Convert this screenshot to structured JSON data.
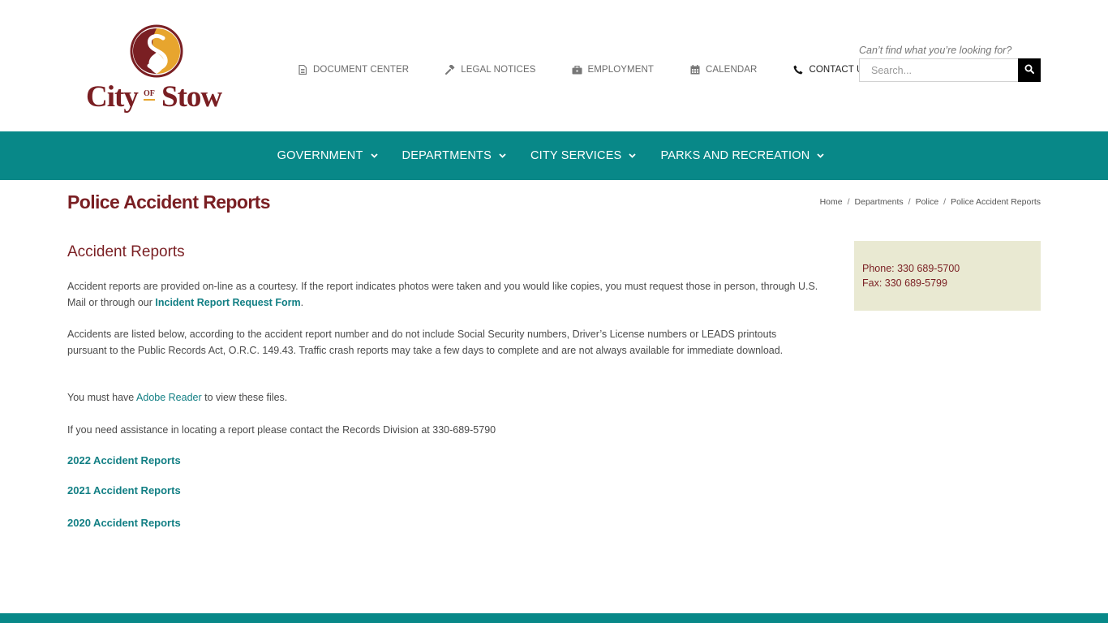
{
  "brand": {
    "logo_city": "City",
    "logo_of": "OF",
    "logo_stow": "Stow",
    "colors": {
      "maroon": "#7a1f23",
      "gold": "#e7a52e",
      "teal": "#088888",
      "sidebar_bg": "#e9e9d2"
    }
  },
  "topnav": [
    {
      "label": "DOCUMENT CENTER",
      "icon": "document-icon"
    },
    {
      "label": "LEGAL NOTICES",
      "icon": "gavel-icon"
    },
    {
      "label": "EMPLOYMENT",
      "icon": "briefcase-icon"
    },
    {
      "label": "CALENDAR",
      "icon": "calendar-icon"
    },
    {
      "label": "CONTACT US",
      "icon": "phone-icon"
    }
  ],
  "search": {
    "hint": "Can’t find what you’re looking for?",
    "placeholder": "Search...",
    "icon": "search-icon"
  },
  "mainnav": [
    {
      "label": "GOVERNMENT"
    },
    {
      "label": "DEPARTMENTS"
    },
    {
      "label": "CITY SERVICES"
    },
    {
      "label": "PARKS AND RECREATION"
    }
  ],
  "page": {
    "title": "Police Accident Reports",
    "breadcrumb": [
      "Home",
      "Departments",
      "Police",
      "Police Accident Reports"
    ]
  },
  "content": {
    "heading": "Accident Reports",
    "p1_text": "Accident reports are provided on-line as a courtesy.  If the report indicates photos were taken and you would like copies, you must request those in person, through U.S. Mail or through our ",
    "p1_link": "Incident Report Request Form",
    "p1_end": ".",
    "p2": "Accidents are listed below, according to the accident report number and do not include Social Security numbers, Driver’s License numbers or LEADS printouts pursuant to the Public Records Act, O.R.C. 149.43. Traffic crash reports may take a few days to complete and are not always available for immediate download.",
    "p3_before": "You must have ",
    "p3_link": "Adobe Reader",
    "p3_after": " to view these files.",
    "p4": "If you need assistance in locating a report please contact the Records Division at 330-689-5790",
    "year_links": [
      "2022 Accident Reports",
      "2021 Accident Reports",
      "2020 Accident Reports"
    ]
  },
  "sidebar": {
    "phone": "Phone: 330 689-5700",
    "fax": "Fax: 330 689-5799"
  }
}
